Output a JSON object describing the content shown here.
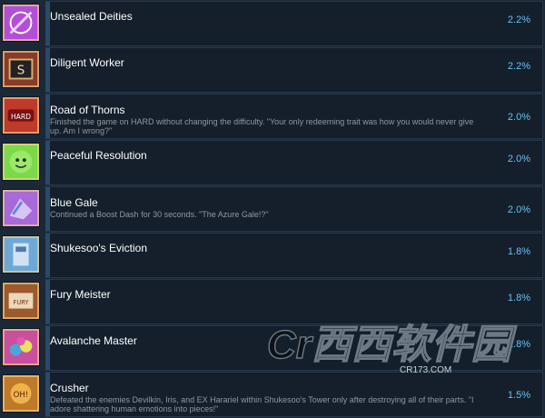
{
  "achievements": [
    {
      "title": "Unsealed Deities",
      "description": "",
      "percent": "2.2%",
      "icon": "unsealed-deities-icon",
      "color": "#b34fd6"
    },
    {
      "title": "Diligent Worker",
      "description": "",
      "percent": "2.2%",
      "icon": "diligent-worker-icon",
      "color": "#8a3a2a"
    },
    {
      "title": "Road of Thorns",
      "description": "Finished the game on HARD without changing the difficulty. \"Your only redeeming trait was how you would never give up. Am I wrong?\"",
      "percent": "2.0%",
      "icon": "road-of-thorns-icon",
      "color": "#c0392b"
    },
    {
      "title": "Peaceful Resolution",
      "description": "",
      "percent": "2.0%",
      "icon": "peaceful-resolution-icon",
      "color": "#7bd94a"
    },
    {
      "title": "Blue Gale",
      "description": "Continued a Boost Dash for 30 seconds. \"The Azure Gale!?\"",
      "percent": "2.0%",
      "icon": "blue-gale-icon",
      "color": "#a86ad8"
    },
    {
      "title": "Shukesoo's Eviction",
      "description": "",
      "percent": "1.8%",
      "icon": "shukesoos-eviction-icon",
      "color": "#6fa8d6"
    },
    {
      "title": "Fury Meister",
      "description": "",
      "percent": "1.8%",
      "icon": "fury-meister-icon",
      "color": "#9c5a2e"
    },
    {
      "title": "Avalanche Master",
      "description": "",
      "percent": "1.8%",
      "icon": "avalanche-master-icon",
      "color": "#c94fa0"
    },
    {
      "title": "Crusher",
      "description": "Defeated the enemies Devilkin, Iris, and EX Harariel within Shukesoo's Tower only after destroying all of their parts. \"I adore shattering human emotions into pieces!\"",
      "percent": "1.5%",
      "icon": "crusher-icon",
      "color": "#c0792b"
    }
  ],
  "watermark": {
    "main": "Cr西西软件园",
    "sub": "CR173.COM"
  }
}
